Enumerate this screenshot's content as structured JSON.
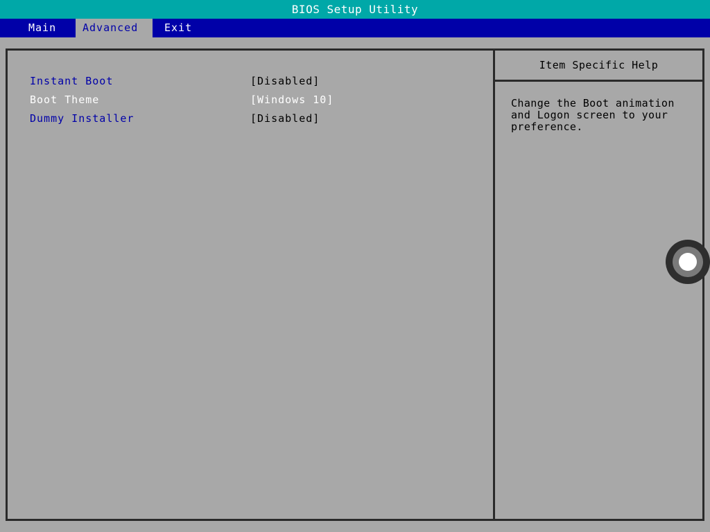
{
  "window": {
    "title": "BIOS Setup Utility"
  },
  "menu": {
    "tabs": [
      {
        "label": "Main",
        "active": false
      },
      {
        "label": "Advanced",
        "active": true
      },
      {
        "label": "Exit",
        "active": false
      }
    ]
  },
  "settings": {
    "items": [
      {
        "label": "Instant Boot",
        "value": "[Disabled]",
        "selected": false
      },
      {
        "label": "Boot Theme",
        "value": "[Windows 10]",
        "selected": true
      },
      {
        "label": "Dummy Installer",
        "value": "[Disabled]",
        "selected": false
      }
    ]
  },
  "help": {
    "header": "Item Specific Help",
    "text": "Change the Boot animation\nand Logon screen to your\npreference."
  },
  "colors": {
    "title_bar": "#00a8a8",
    "menu_bar": "#0000a8",
    "background": "#a8a8a8",
    "label_text": "#0000a8",
    "selected_text": "#ffffff",
    "border": "#2a2a2a"
  },
  "icons": {
    "touch_cursor": "circle-cursor-icon"
  }
}
